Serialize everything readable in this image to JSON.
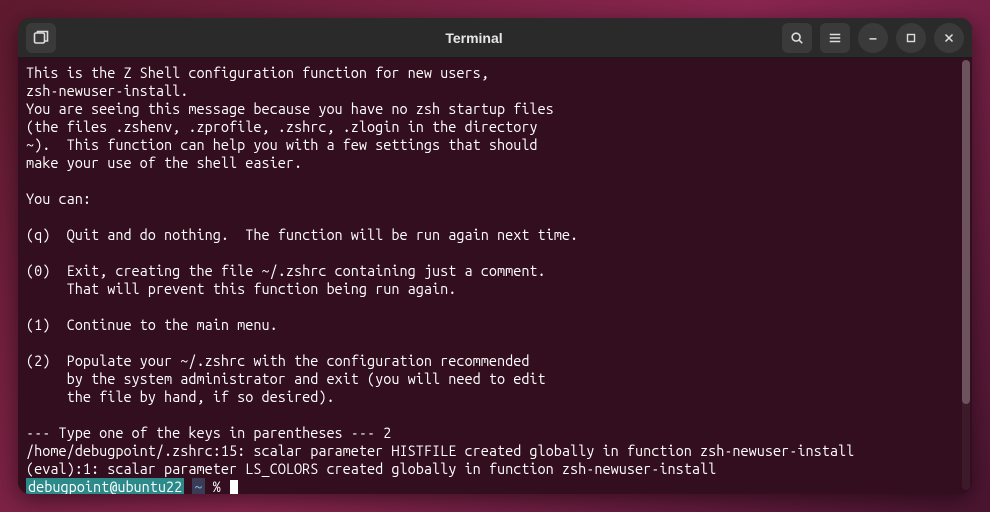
{
  "window": {
    "title": "Terminal"
  },
  "terminal": {
    "lines": [
      "This is the Z Shell configuration function for new users,",
      "zsh-newuser-install.",
      "You are seeing this message because you have no zsh startup files",
      "(the files .zshenv, .zprofile, .zshrc, .zlogin in the directory",
      "~).  This function can help you with a few settings that should",
      "make your use of the shell easier.",
      "",
      "You can:",
      "",
      "(q)  Quit and do nothing.  The function will be run again next time.",
      "",
      "(0)  Exit, creating the file ~/.zshrc containing just a comment.",
      "     That will prevent this function being run again.",
      "",
      "(1)  Continue to the main menu.",
      "",
      "(2)  Populate your ~/.zshrc with the configuration recommended",
      "     by the system administrator and exit (you will need to edit",
      "     the file by hand, if so desired).",
      "",
      "--- Type one of the keys in parentheses --- 2",
      "/home/debugpoint/.zshrc:15: scalar parameter HISTFILE created globally in function zsh-newuser-install",
      "(eval):1: scalar parameter LS_COLORS created globally in function zsh-newuser-install"
    ],
    "prompt": {
      "user": "debugpoint@ubuntu22",
      "path": "~",
      "symbol": "%"
    }
  },
  "icons": {
    "new_tab": "new-tab-icon",
    "search": "search-icon",
    "menu": "hamburger-menu-icon",
    "minimize": "minimize-icon",
    "maximize": "maximize-icon",
    "close": "close-icon"
  }
}
